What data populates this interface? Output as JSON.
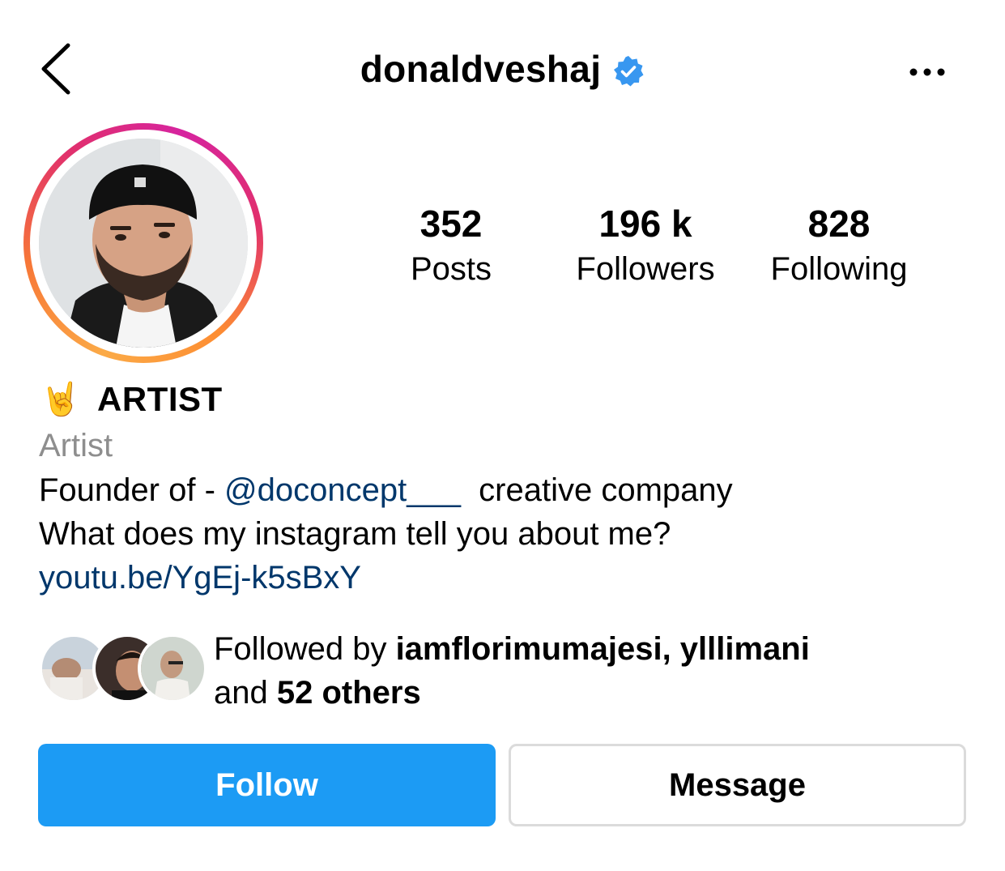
{
  "header": {
    "back_icon": "chevron-left-icon",
    "username": "donaldveshaj",
    "verified_icon": "verified-badge-icon",
    "more_icon": "more-horizontal-icon"
  },
  "profile": {
    "avatar": "profile-photo",
    "stats": [
      {
        "value": "352",
        "label": "Posts"
      },
      {
        "value": "196 k",
        "label": "Followers"
      },
      {
        "value": "828",
        "label": "Following"
      }
    ]
  },
  "bio": {
    "emoji": "🤘",
    "display_name": "ARTIST",
    "category": "Artist",
    "line1_prefix": "Founder of - ",
    "line1_mention": "@doconcept___",
    "line1_suffix": "  creative company",
    "line2": "What does my instagram tell you about me?",
    "link": "youtu.be/YgEj-k5sBxY"
  },
  "followed_by": {
    "prefix": "Followed by ",
    "names": "iamflorimumajesi, ylllimani",
    "and": "and ",
    "others": "52 others"
  },
  "actions": {
    "follow_label": "Follow",
    "message_label": "Message"
  },
  "colors": {
    "follow_blue": "#1c9bf4",
    "link_blue": "#00376b",
    "verified_blue": "#3897f0",
    "muted_gray": "#8e8e8e"
  }
}
